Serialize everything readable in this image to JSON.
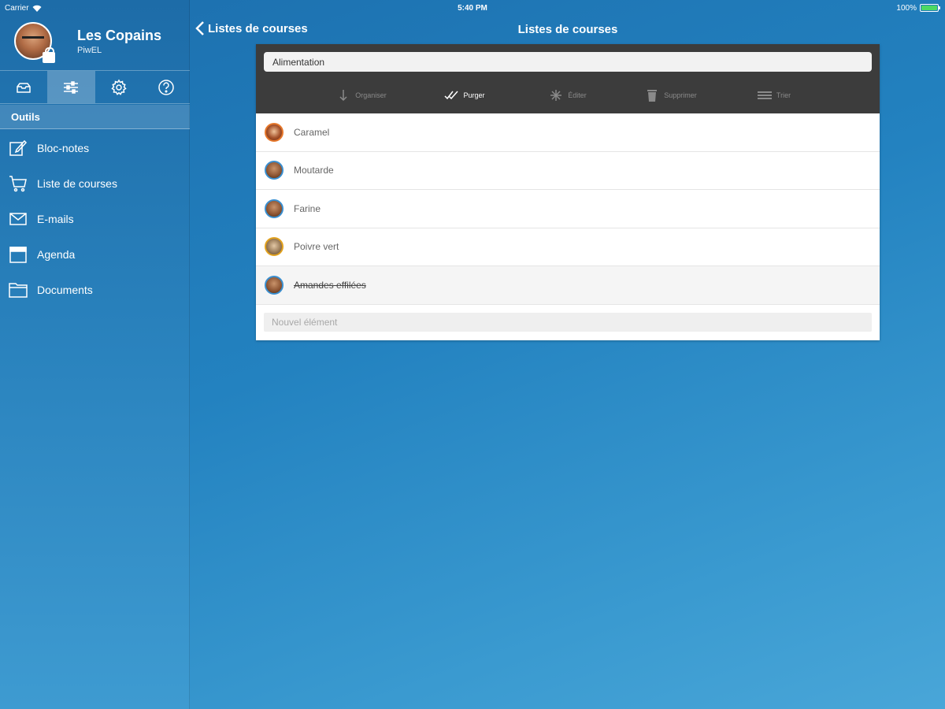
{
  "status_bar": {
    "carrier": "Carrier",
    "time": "5:40 PM",
    "battery": "100%",
    "battery_level": 1.0
  },
  "sidebar": {
    "group_name": "Les Copains",
    "user_name": "PiwEL",
    "tabs": [
      {
        "name": "mail",
        "icon": "mail-icon"
      },
      {
        "name": "tools",
        "icon": "sliders-icon",
        "active": true
      },
      {
        "name": "settings",
        "icon": "gear-icon"
      },
      {
        "name": "help",
        "icon": "help-icon"
      }
    ],
    "section_title": "Outils",
    "items": [
      {
        "label": "Bloc-notes",
        "icon": "notepad-icon"
      },
      {
        "label": "Liste de courses",
        "icon": "cart-icon"
      },
      {
        "label": "E-mails",
        "icon": "envelope-icon"
      },
      {
        "label": "Agenda",
        "icon": "calendar-icon"
      },
      {
        "label": "Documents",
        "icon": "folder-icon"
      }
    ]
  },
  "navbar": {
    "back_label": "Listes de courses",
    "title": "Listes de courses"
  },
  "list": {
    "name": "Alimentation",
    "toolbar": [
      {
        "label": "Organiser",
        "icon": "arrow-down-icon",
        "enabled": false
      },
      {
        "label": "Purger",
        "icon": "double-check-icon",
        "enabled": true
      },
      {
        "label": "Éditer",
        "icon": "asterisk-icon",
        "enabled": false
      },
      {
        "label": "Supprimer",
        "icon": "trash-icon",
        "enabled": false
      },
      {
        "label": "Trier",
        "icon": "lines-icon",
        "enabled": false
      }
    ],
    "items": [
      {
        "text": "Caramel",
        "checked": false,
        "avatar": "orange"
      },
      {
        "text": "Moutarde",
        "checked": false,
        "avatar": "blue"
      },
      {
        "text": "Farine",
        "checked": false,
        "avatar": "blue"
      },
      {
        "text": "Poivre vert",
        "checked": false,
        "avatar": "yellow"
      },
      {
        "text": "Amandes effilées",
        "checked": true,
        "avatar": "blue"
      }
    ],
    "new_item_placeholder": "Nouvel élément"
  },
  "colors": {
    "background": "#2382c0",
    "panel_header": "#3c3c3c",
    "battery": "#4cd964"
  }
}
